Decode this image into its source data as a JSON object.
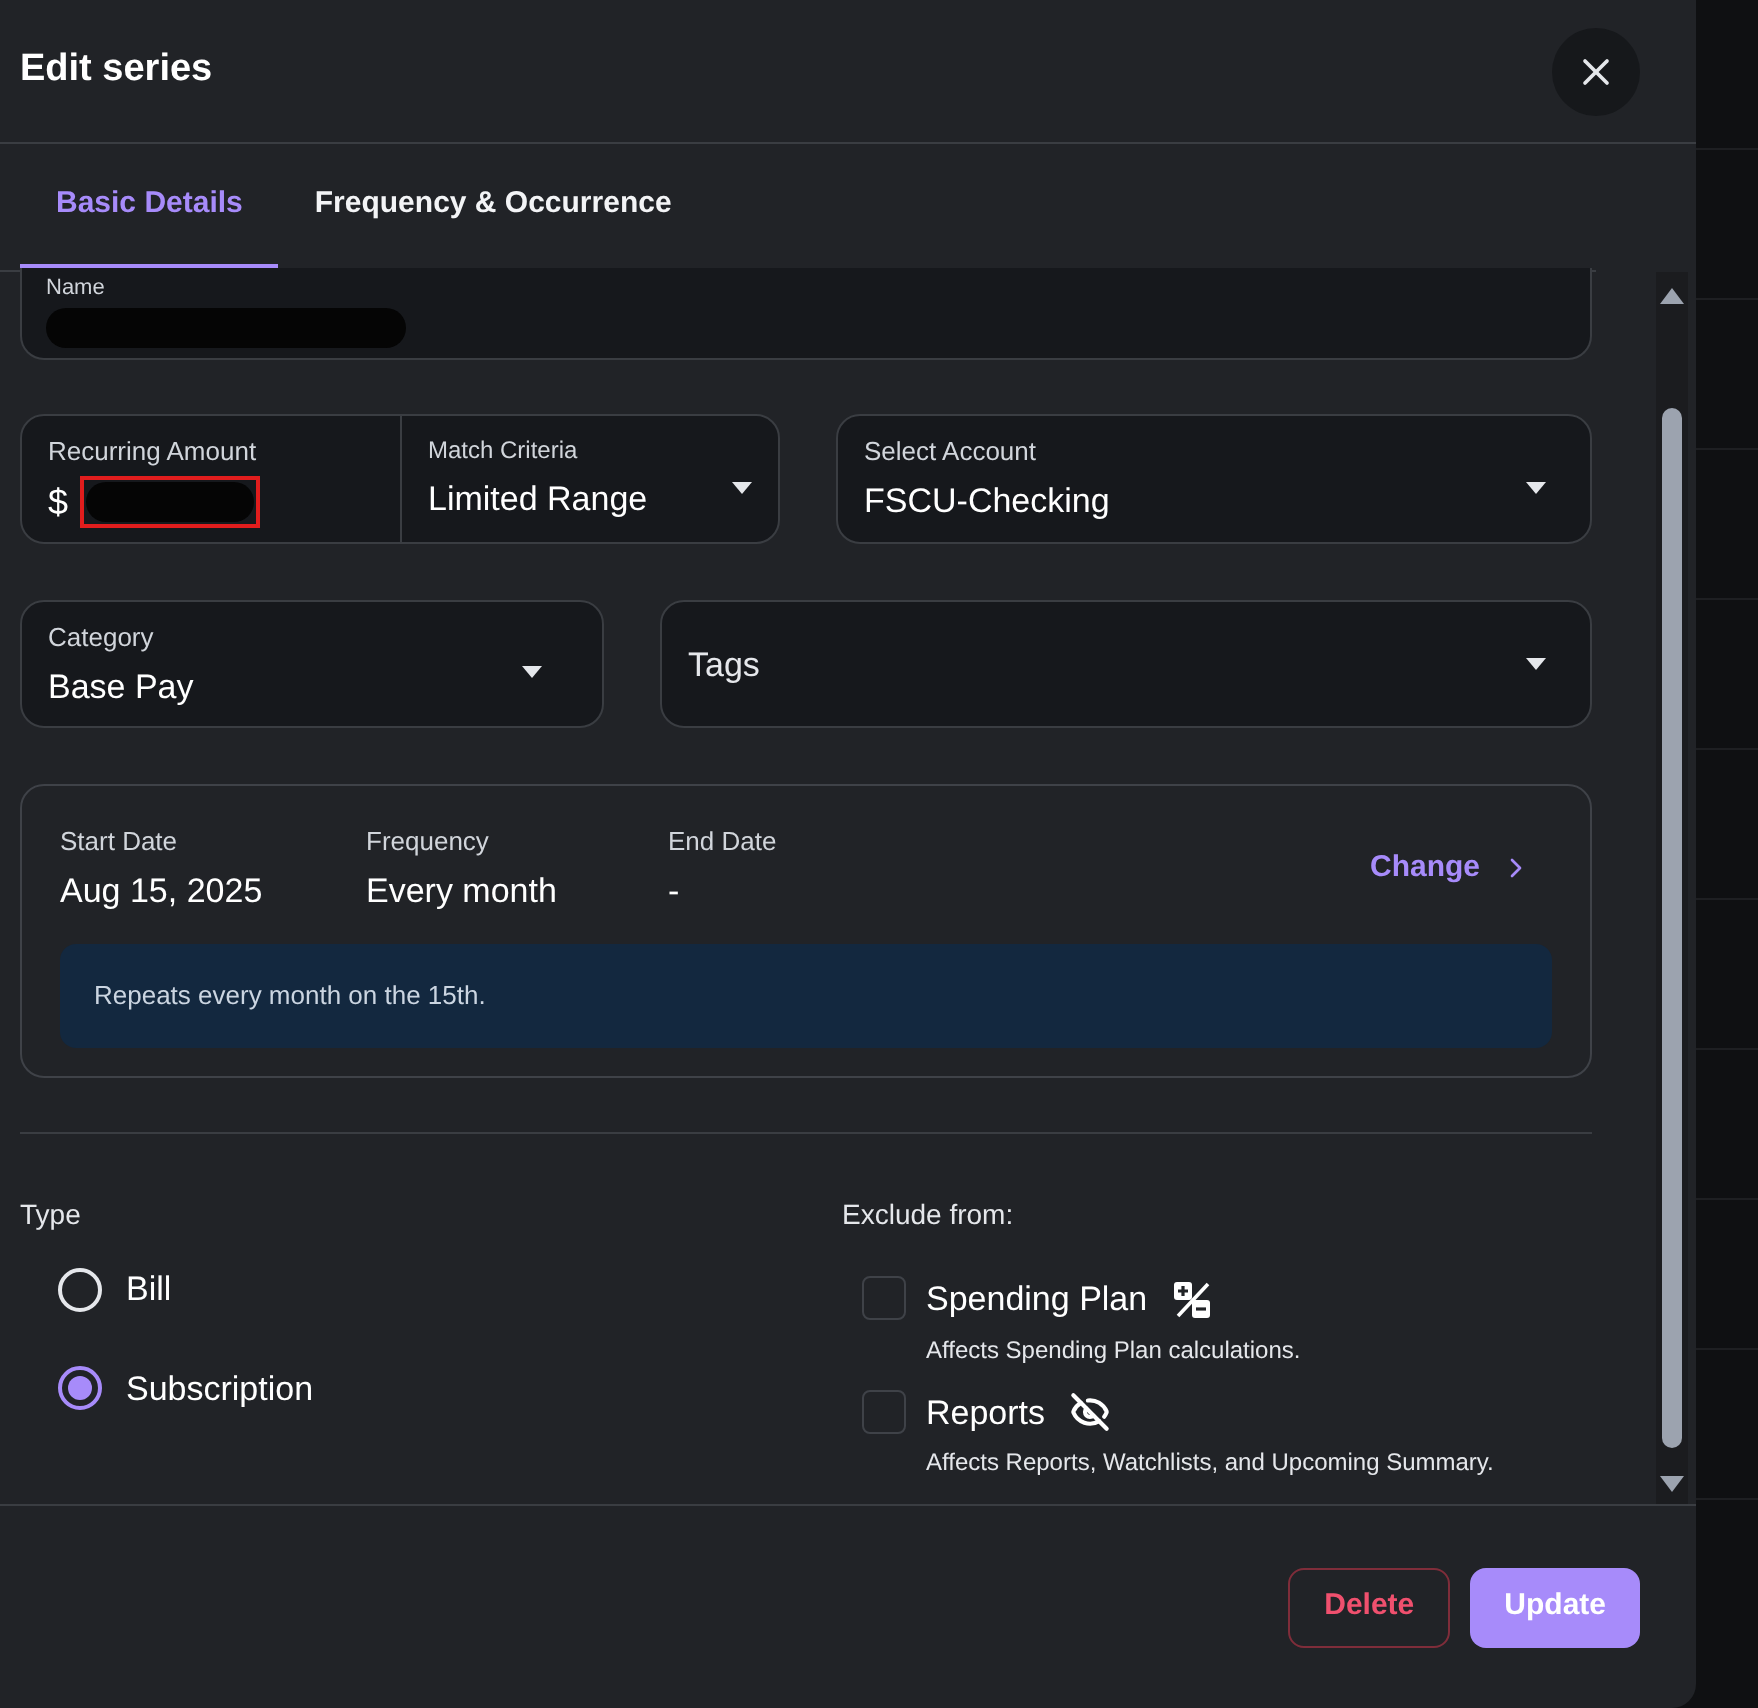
{
  "dialog": {
    "title": "Edit series"
  },
  "tabs": [
    {
      "label": "Basic Details",
      "selected": true
    },
    {
      "label": "Frequency & Occurrence",
      "selected": false
    }
  ],
  "name_field": {
    "label": "Name",
    "redacted": true
  },
  "amount_field": {
    "label": "Recurring Amount",
    "prefix": "$",
    "redacted": true
  },
  "match_criteria": {
    "label": "Match Criteria",
    "value": "Limited Range"
  },
  "account": {
    "label": "Select Account",
    "value": "FSCU-Checking"
  },
  "category": {
    "label": "Category",
    "value": "Base Pay"
  },
  "tags": {
    "placeholder": "Tags"
  },
  "schedule": {
    "items": [
      {
        "label": "Start Date",
        "value": "Aug 15, 2025"
      },
      {
        "label": "Frequency",
        "value": "Every month"
      },
      {
        "label": "End Date",
        "value": "-"
      }
    ],
    "change_link": "Change",
    "summary": "Repeats every month on the 15th."
  },
  "type": {
    "label": "Type",
    "options": [
      {
        "label": "Bill",
        "selected": false
      },
      {
        "label": "Subscription",
        "selected": true
      }
    ]
  },
  "exclude": {
    "label": "Exclude from:",
    "options": [
      {
        "kind": "plan",
        "label": "Spending Plan",
        "description": "Affects Spending Plan calculations.",
        "checked": false
      },
      {
        "kind": "reports",
        "label": "Reports",
        "description": "Affects Reports, Watchlists, and Upcoming Summary.",
        "checked": false
      }
    ]
  },
  "buttons": {
    "delete": "Delete",
    "update": "Update"
  }
}
